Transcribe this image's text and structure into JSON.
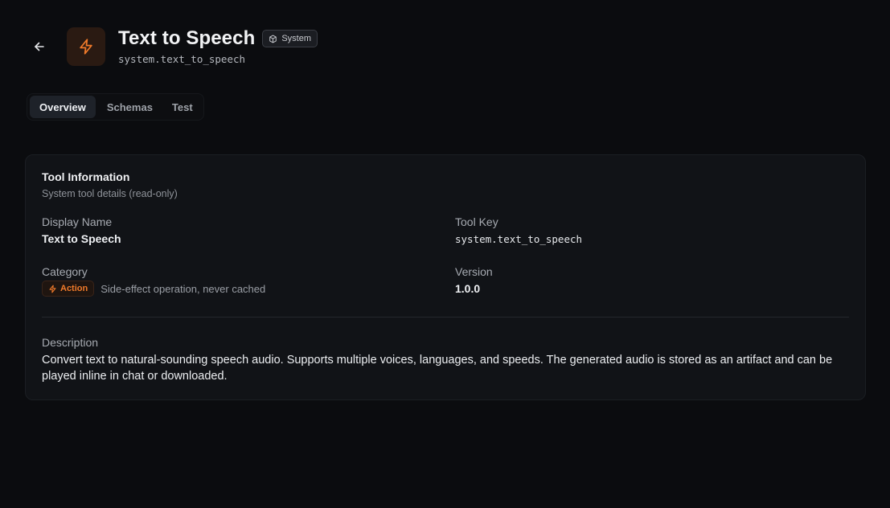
{
  "header": {
    "title": "Text to Speech",
    "badge_label": "System",
    "tool_key": "system.text_to_speech"
  },
  "tabs": [
    {
      "label": "Overview",
      "active": true
    },
    {
      "label": "Schemas",
      "active": false
    },
    {
      "label": "Test",
      "active": false
    }
  ],
  "card": {
    "title": "Tool Information",
    "subtitle": "System tool details (read-only)",
    "display_name": {
      "label": "Display Name",
      "value": "Text to Speech"
    },
    "tool_key": {
      "label": "Tool Key",
      "value": "system.text_to_speech"
    },
    "category": {
      "label": "Category",
      "badge": "Action",
      "description": "Side-effect operation, never cached"
    },
    "version": {
      "label": "Version",
      "value": "1.0.0"
    },
    "description": {
      "label": "Description",
      "value": "Convert text to natural-sounding speech audio. Supports multiple voices, languages, and speeds. The generated audio is stored as an artifact and can be played inline in chat or downloaded."
    }
  },
  "colors": {
    "background": "#0b0c0f",
    "card": "#111317",
    "accent_orange": "#f07a2a"
  },
  "icons": {
    "back": "arrow-left-icon",
    "tool": "lightning-bolt-icon",
    "system_badge": "cube-icon",
    "action_badge": "lightning-bolt-icon"
  }
}
